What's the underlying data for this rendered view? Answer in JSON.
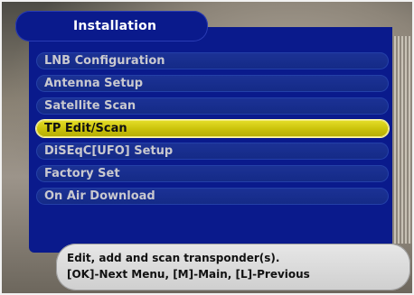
{
  "title": "Installation",
  "menu": {
    "items": [
      {
        "label": "LNB Configuration"
      },
      {
        "label": "Antenna Setup"
      },
      {
        "label": "Satellite Scan"
      },
      {
        "label": "TP Edit/Scan"
      },
      {
        "label": "DiSEqC[UFO] Setup"
      },
      {
        "label": "Factory Set"
      },
      {
        "label": "On Air Download"
      }
    ],
    "selected_index": 3
  },
  "help": {
    "line1": "Edit, add and scan transponder(s).",
    "line2": "[OK]-Next Menu, [M]-Main, [L]-Previous"
  },
  "colors": {
    "panel": "#0a1a8c",
    "menu_item": "#1c3296",
    "selected": "#d8cf12",
    "help_bg": "#e0e0e0"
  }
}
